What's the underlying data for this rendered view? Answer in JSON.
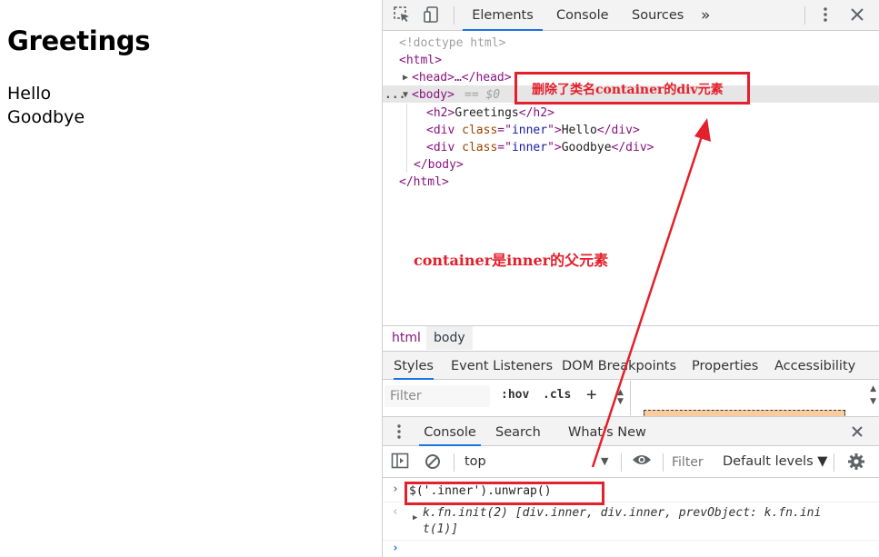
{
  "page": {
    "heading": "Greetings",
    "items": [
      "Hello",
      "Goodbye"
    ]
  },
  "devtools": {
    "tabs": [
      "Elements",
      "Console",
      "Sources"
    ],
    "more_tabs": "»",
    "dom": {
      "doctype": "<!doctype html>",
      "html_open": "<html>",
      "head": "<head>…</head>",
      "body_open": "<body>",
      "body_marker": "== $0",
      "h2": "Greetings",
      "div_class": "inner",
      "div1_text": "Hello",
      "div2_text": "Goodbye",
      "body_close": "</body>",
      "html_close": "</html>",
      "ellipsis": "..."
    },
    "breadcrumbs": [
      "html",
      "body"
    ],
    "panel_tabs": [
      "Styles",
      "Event Listeners",
      "DOM Breakpoints",
      "Properties",
      "Accessibility"
    ],
    "styles_filter_placeholder": "Filter",
    "hov": ":hov",
    "cls": ".cls",
    "plus": "+",
    "drawer_tabs": [
      "Console",
      "Search",
      "What's New"
    ],
    "context": "top",
    "console_filter_placeholder": "Filter",
    "levels": "Default levels ▼",
    "console": {
      "input": "$('.inner').unwrap()",
      "output_line1": "k.fn.init(2) [div.inner, div.inner, prevObject: k.fn.ini",
      "output_line2": "t(1)]"
    }
  },
  "annotations": {
    "box_label": "删除了类名container的div元素",
    "note": "container是inner的父元素",
    "color": "#e3202c"
  }
}
